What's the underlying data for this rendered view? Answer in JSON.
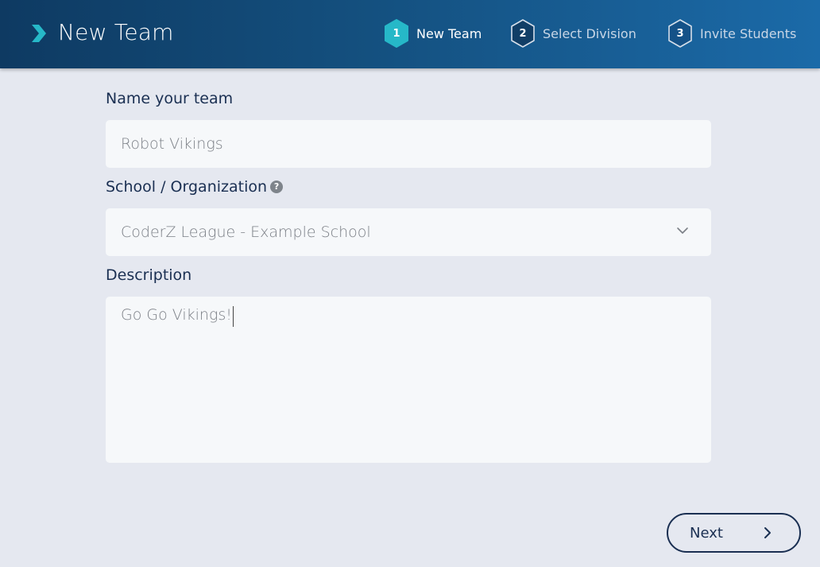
{
  "header": {
    "title": "New Team",
    "steps": [
      {
        "number": "1",
        "label": "New Team",
        "active": true
      },
      {
        "number": "2",
        "label": "Select Division",
        "active": false
      },
      {
        "number": "3",
        "label": "Invite Students",
        "active": false
      }
    ]
  },
  "form": {
    "name_label": "Name your team",
    "name_value": "Robot Vikings",
    "org_label": "School / Organization",
    "org_help": "?",
    "org_value": "CoderZ League - Example School",
    "description_label": "Description",
    "description_value": "Go Go Vikings!"
  },
  "footer": {
    "next_label": "Next"
  },
  "colors": {
    "accent": "#26b8c8",
    "header_dark": "#0e3a62",
    "header_light": "#1b6aa8",
    "text_dark": "#1a2f52"
  },
  "icons": {
    "header_arrow": "chevron-right-icon",
    "org_help": "help-icon",
    "org_dropdown": "chevron-down-icon",
    "next": "chevron-right-icon"
  }
}
